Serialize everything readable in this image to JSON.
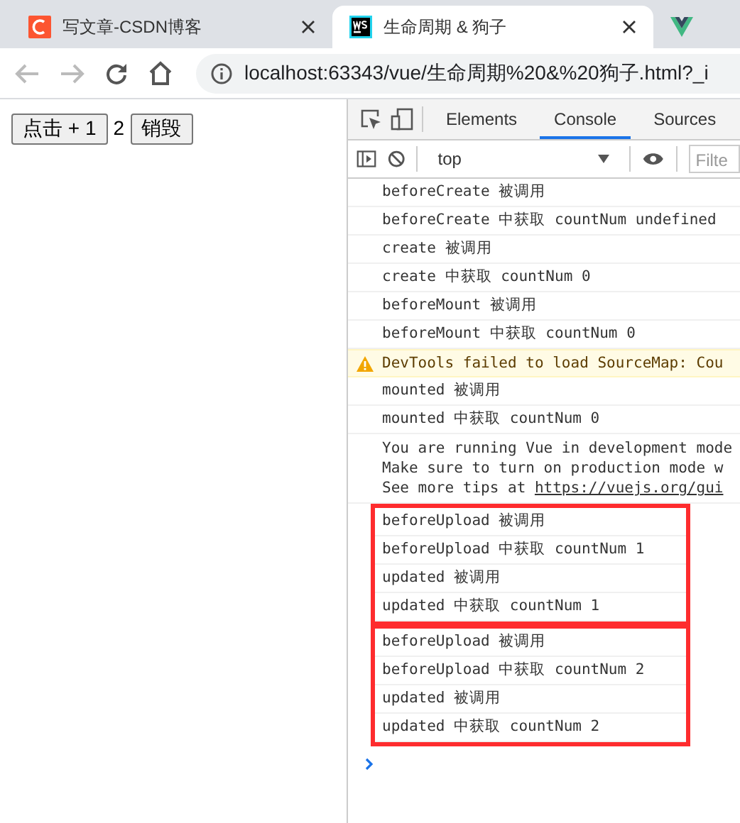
{
  "browser_tabs": [
    {
      "kind": "csdn",
      "title": "写文章-CSDN博客",
      "selected": false
    },
    {
      "kind": "webstorm",
      "title": "生命周期 & 狗子",
      "selected": true
    },
    {
      "kind": "vue",
      "selected": false
    }
  ],
  "address": "localhost:63343/vue/生命周期%20&%20狗子.html?_i",
  "page": {
    "increment_button": "点击 + 1",
    "count": "2",
    "destroy_button": "销毁"
  },
  "devtools": {
    "tabs": [
      {
        "label": "Elements",
        "selected": false
      },
      {
        "label": "Console",
        "selected": true
      },
      {
        "label": "Sources",
        "selected": false
      }
    ],
    "context": "top",
    "filter_placeholder": "Filte",
    "messages": [
      {
        "kind": "log",
        "text": "beforeCreate 被调用"
      },
      {
        "kind": "log",
        "text": "beforeCreate 中获取 countNum undefined"
      },
      {
        "kind": "log",
        "text": "create 被调用"
      },
      {
        "kind": "log",
        "text": "create 中获取 countNum 0"
      },
      {
        "kind": "log",
        "text": "beforeMount 被调用"
      },
      {
        "kind": "log",
        "text": "beforeMount 中获取 countNum 0"
      },
      {
        "kind": "warning",
        "text": "DevTools failed to load SourceMap: Cou"
      },
      {
        "kind": "log",
        "text": "mounted 被调用"
      },
      {
        "kind": "log",
        "text": "mounted 中获取 countNum 0"
      },
      {
        "kind": "info",
        "lines": [
          "You are running Vue in development mode",
          "Make sure to turn on production mode w"
        ],
        "link_prefix": "See more tips at ",
        "link": "https://vuejs.org/gui"
      }
    ],
    "highlighted_groups": [
      {
        "messages": [
          {
            "kind": "log",
            "text": "beforeUpload 被调用"
          },
          {
            "kind": "log",
            "text": "beforeUpload 中获取 countNum 1"
          },
          {
            "kind": "log",
            "text": "updated 被调用"
          },
          {
            "kind": "log",
            "text": "updated 中获取 countNum 1"
          }
        ]
      },
      {
        "messages": [
          {
            "kind": "log",
            "text": "beforeUpload 被调用"
          },
          {
            "kind": "log",
            "text": "beforeUpload 中获取 countNum 2"
          },
          {
            "kind": "log",
            "text": "updated 被调用"
          },
          {
            "kind": "log",
            "text": "updated 中获取 countNum 2"
          }
        ]
      }
    ]
  }
}
